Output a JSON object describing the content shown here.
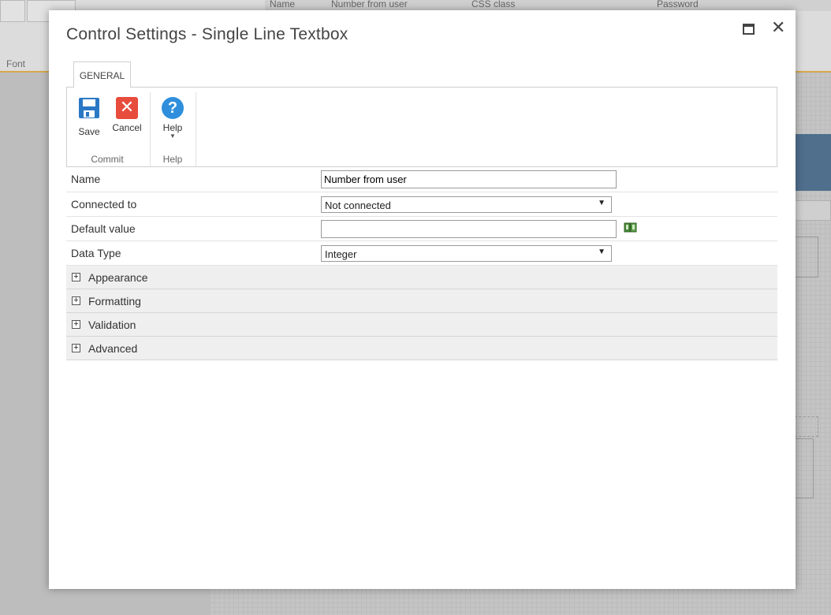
{
  "background": {
    "font_group_label": "Font",
    "header_cells": [
      "Name",
      "Number from user",
      "CSS class",
      "Password"
    ]
  },
  "dialog": {
    "title": "Control Settings - Single Line Textbox",
    "tab": "GENERAL",
    "ribbon": {
      "save_label": "Save",
      "cancel_label": "Cancel",
      "help_label": "Help",
      "commit_group": "Commit",
      "help_group": "Help"
    },
    "properties": {
      "name_label": "Name",
      "name_value": "Number from user",
      "connected_label": "Connected to",
      "connected_value": "Not connected",
      "default_label": "Default value",
      "default_value": "",
      "datatype_label": "Data Type",
      "datatype_value": "Integer"
    },
    "sections": [
      "Appearance",
      "Formatting",
      "Validation",
      "Advanced"
    ]
  },
  "colors": {
    "cancel_red": "#e74c3c",
    "help_blue": "#2f8fdc",
    "save_blue": "#2a78c5"
  }
}
